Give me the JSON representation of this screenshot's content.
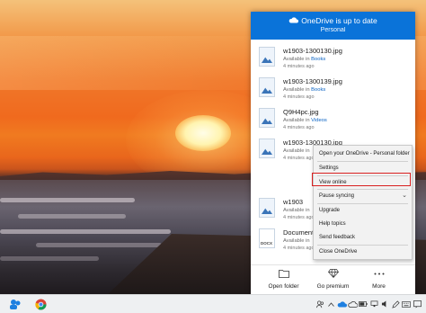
{
  "onedrive": {
    "status": "OneDrive is up to date",
    "account": "Personal",
    "files": [
      {
        "name": "w1903-1300130.jpg",
        "prefix": "Available in",
        "folder": "Books",
        "time": "4 minutes ago",
        "kind": "image"
      },
      {
        "name": "w1903-1300139.jpg",
        "prefix": "Available in",
        "folder": "Books",
        "time": "4 minutes ago",
        "kind": "image"
      },
      {
        "name": "Q9H4pc.jpg",
        "prefix": "Available in",
        "folder": "Videos",
        "time": "4 minutes ago",
        "kind": "image"
      },
      {
        "name": "w1903-1300130.jpg",
        "prefix": "Available in",
        "folder": "",
        "time": "4 minutes ago",
        "kind": "image"
      },
      {
        "name": "w1903",
        "prefix": "Available in",
        "folder": "",
        "time": "4 minutes ago",
        "kind": "image"
      },
      {
        "name": "Document",
        "prefix": "Available in",
        "folder": "",
        "time": "4 minutes ago",
        "kind": "doc"
      }
    ],
    "footer": {
      "open_folder": "Open folder",
      "go_premium": "Go premium",
      "more": "More"
    }
  },
  "context_menu": {
    "items": [
      "Open your OneDrive - Personal folder",
      "Settings",
      "View online",
      "Pause syncing",
      "Upgrade",
      "Help topics",
      "Send feedback",
      "Close OneDrive"
    ],
    "highlighted": "View online"
  },
  "doc_icon_label": "DOCX",
  "icons": {
    "cloud": "cloud-icon",
    "folder": "folder-icon",
    "diamond": "diamond-icon",
    "more": "more-icon"
  }
}
